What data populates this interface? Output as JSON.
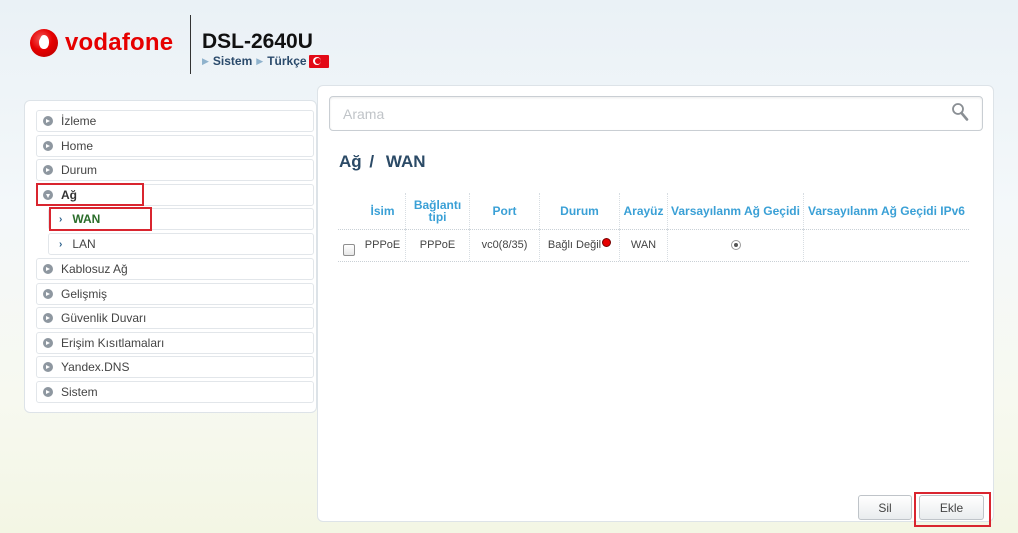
{
  "header": {
    "logo_text": "vodafone",
    "model": "DSL-2640U",
    "link_system": "Sistem",
    "link_language": "Türkçe"
  },
  "sidebar": {
    "items": [
      {
        "label": "İzleme"
      },
      {
        "label": "Home"
      },
      {
        "label": "Durum"
      },
      {
        "label": "Ağ"
      },
      {
        "label": "WAN"
      },
      {
        "label": "LAN"
      },
      {
        "label": "Kablosuz Ağ"
      },
      {
        "label": "Gelişmiş"
      },
      {
        "label": "Güvenlik Duvarı"
      },
      {
        "label": "Erişim Kısıtlamaları"
      },
      {
        "label": "Yandex.DNS"
      },
      {
        "label": "Sistem"
      }
    ]
  },
  "search": {
    "placeholder": "Arama",
    "value": ""
  },
  "page": {
    "breadcrumb_parent": "Ağ",
    "separator": "/",
    "title": "WAN"
  },
  "table": {
    "headers": [
      "İsim",
      "Bağlantı tipi",
      "Port",
      "Durum",
      "Arayüz",
      "Varsayılanm Ağ Geçidi",
      "Varsayılanm Ağ Geçidi IPv6"
    ],
    "rows": [
      {
        "name": "PPPoE",
        "type": "PPPoE",
        "port": "vc0(8/35)",
        "status": "Bağlı Değil",
        "interface": "WAN",
        "default_gateway": true,
        "default_gateway_ipv6": false
      }
    ]
  },
  "buttons": {
    "delete": "Sil",
    "add": "Ekle"
  },
  "colors": {
    "brand": "#e60000",
    "header_text": "#3aa0d6",
    "highlight_box": "#d9252f",
    "status_disconnected": "#e60000"
  },
  "icons": {
    "search": "magnifier-icon",
    "status": "red-dot-icon",
    "menu_arrow": "circle-arrow-icon"
  }
}
